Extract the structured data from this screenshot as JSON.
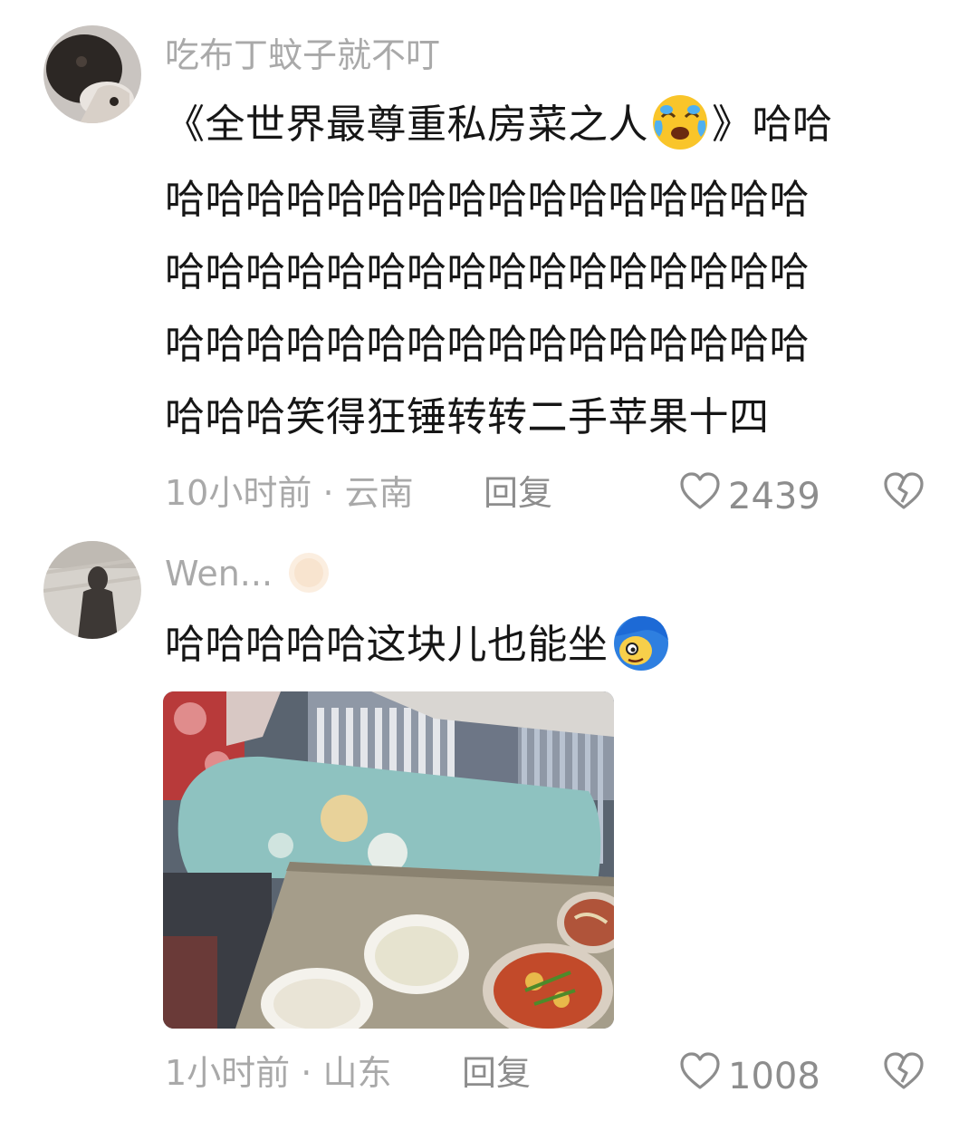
{
  "comments": [
    {
      "username": "吃布丁蚊子就不叮",
      "text_part1": "《全世界最尊重私房菜之人",
      "inline_emoji": "crying-laughing-emoji",
      "text_line1_end": "》哈哈",
      "text_line2": "哈哈哈哈哈哈哈哈哈哈哈哈哈哈哈哈",
      "text_line3": "哈哈哈哈哈哈哈哈哈哈哈哈哈哈哈哈",
      "text_line4": "哈哈哈哈哈哈哈哈哈哈哈哈哈哈哈哈",
      "text_line5": "哈哈哈笑得狂锤转转二手苹果十四",
      "time": "10小时前",
      "separator": "·",
      "location": "云南",
      "reply_label": "回复",
      "like_count": "2439"
    },
    {
      "username": "Wen...",
      "username_badge": "moon-badge-icon",
      "text": "哈哈哈哈哈这块儿也能坐",
      "inline_emoji": "blue-hair-face-emoji",
      "time": "1小时前",
      "separator": "·",
      "location": "山东",
      "reply_label": "回复",
      "like_count": "1008"
    }
  ],
  "colors": {
    "meta_gray": "#a9a9a9",
    "text": "#161616",
    "icon_gray": "#8d8d8d"
  }
}
